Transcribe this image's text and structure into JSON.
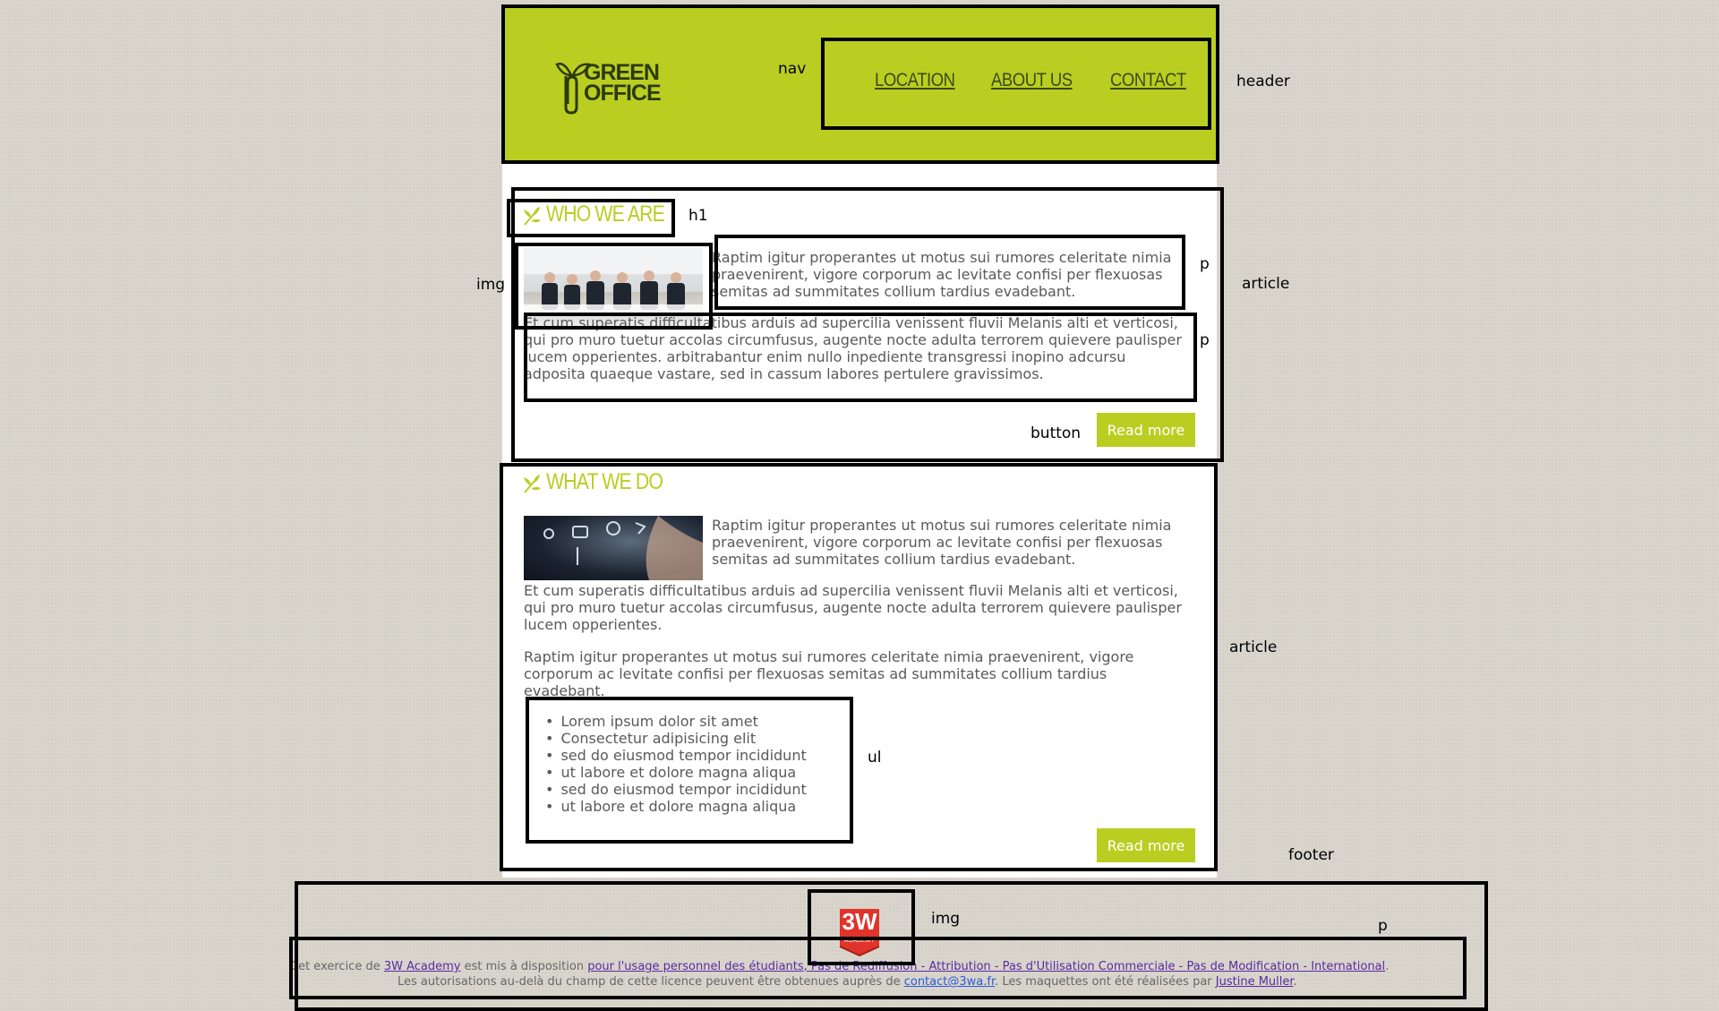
{
  "logo": {
    "line1": "GREEN",
    "line2": "OFFICE"
  },
  "nav": {
    "items": [
      {
        "label": "LOCATION"
      },
      {
        "label": "ABOUT US"
      },
      {
        "label": "CONTACT"
      }
    ]
  },
  "annotations": {
    "nav": "nav",
    "header": "header",
    "h1": "h1",
    "img": "img",
    "p1": "p",
    "p2": "p",
    "article1": "article",
    "button": "button",
    "article2": "article",
    "ul": "ul",
    "footer": "footer",
    "footer_img": "img",
    "footer_p": "p"
  },
  "article1": {
    "title": "WHO WE ARE",
    "p1": "Raptim igitur properantes ut motus sui rumores celeritate nimia praevenirent, vigore corporum ac levitate confisi per flexuosas semitas ad summitates collium tardius evadebant.",
    "p2": "Et cum superatis difficultatibus arduis ad supercilia venissent fluvii Melanis alti et verticosi, qui pro muro tuetur accolas circumfusus, augente nocte adulta terrorem quievere paulisper lucem opperientes. arbitrabantur enim nullo inpediente transgressi inopino adcursu adposita quaeque vastare, sed in cassum labores pertulere gravissimos.",
    "button": "Read more"
  },
  "article2": {
    "title": "WHAT WE DO",
    "p1": "Raptim igitur properantes ut motus sui rumores celeritate nimia praevenirent, vigore corporum ac levitate confisi per flexuosas semitas ad summitates collium tardius evadebant.",
    "p2": "Et cum superatis difficultatibus arduis ad supercilia venissent fluvii Melanis alti et verticosi, qui pro muro tuetur accolas circumfusus, augente nocte adulta terrorem quievere paulisper lucem opperientes.",
    "p3": "Raptim igitur properantes ut motus sui rumores celeritate nimia praevenirent, vigore corporum ac levitate confisi per flexuosas semitas ad summitates collium tardius evadebant.",
    "list": [
      "Lorem ipsum dolor sit amet",
      "Consectetur adipisicing elit",
      "sed do eiusmod tempor incididunt",
      "ut labore et dolore magna aliqua",
      "sed do eiusmod tempor incididunt",
      "ut labore et dolore magna aliqua"
    ],
    "button": "Read more"
  },
  "footer": {
    "badge_text": "3W",
    "badge_sub": "ACADEMY",
    "line1_pre": "Cet exercice de ",
    "line1_link1": "3W Academy",
    "line1_mid": " est mis à disposition ",
    "line1_link2": "pour l'usage personnel des étudiants, Pas de Rediffusion - Attribution - Pas d'Utilisation Commerciale - Pas de Modification - International",
    "line1_end": ".",
    "line2_pre": "Les autorisations au-delà du champ de cette licence peuvent être obtenues auprès de ",
    "line2_email": "contact@3wa.fr",
    "line2_mid": ". Les maquettes ont été réalisées par ",
    "line2_author": "Justine Muller",
    "line2_end": "."
  },
  "colors": {
    "accent": "#b9ce21",
    "text": "#5a5a5a"
  }
}
